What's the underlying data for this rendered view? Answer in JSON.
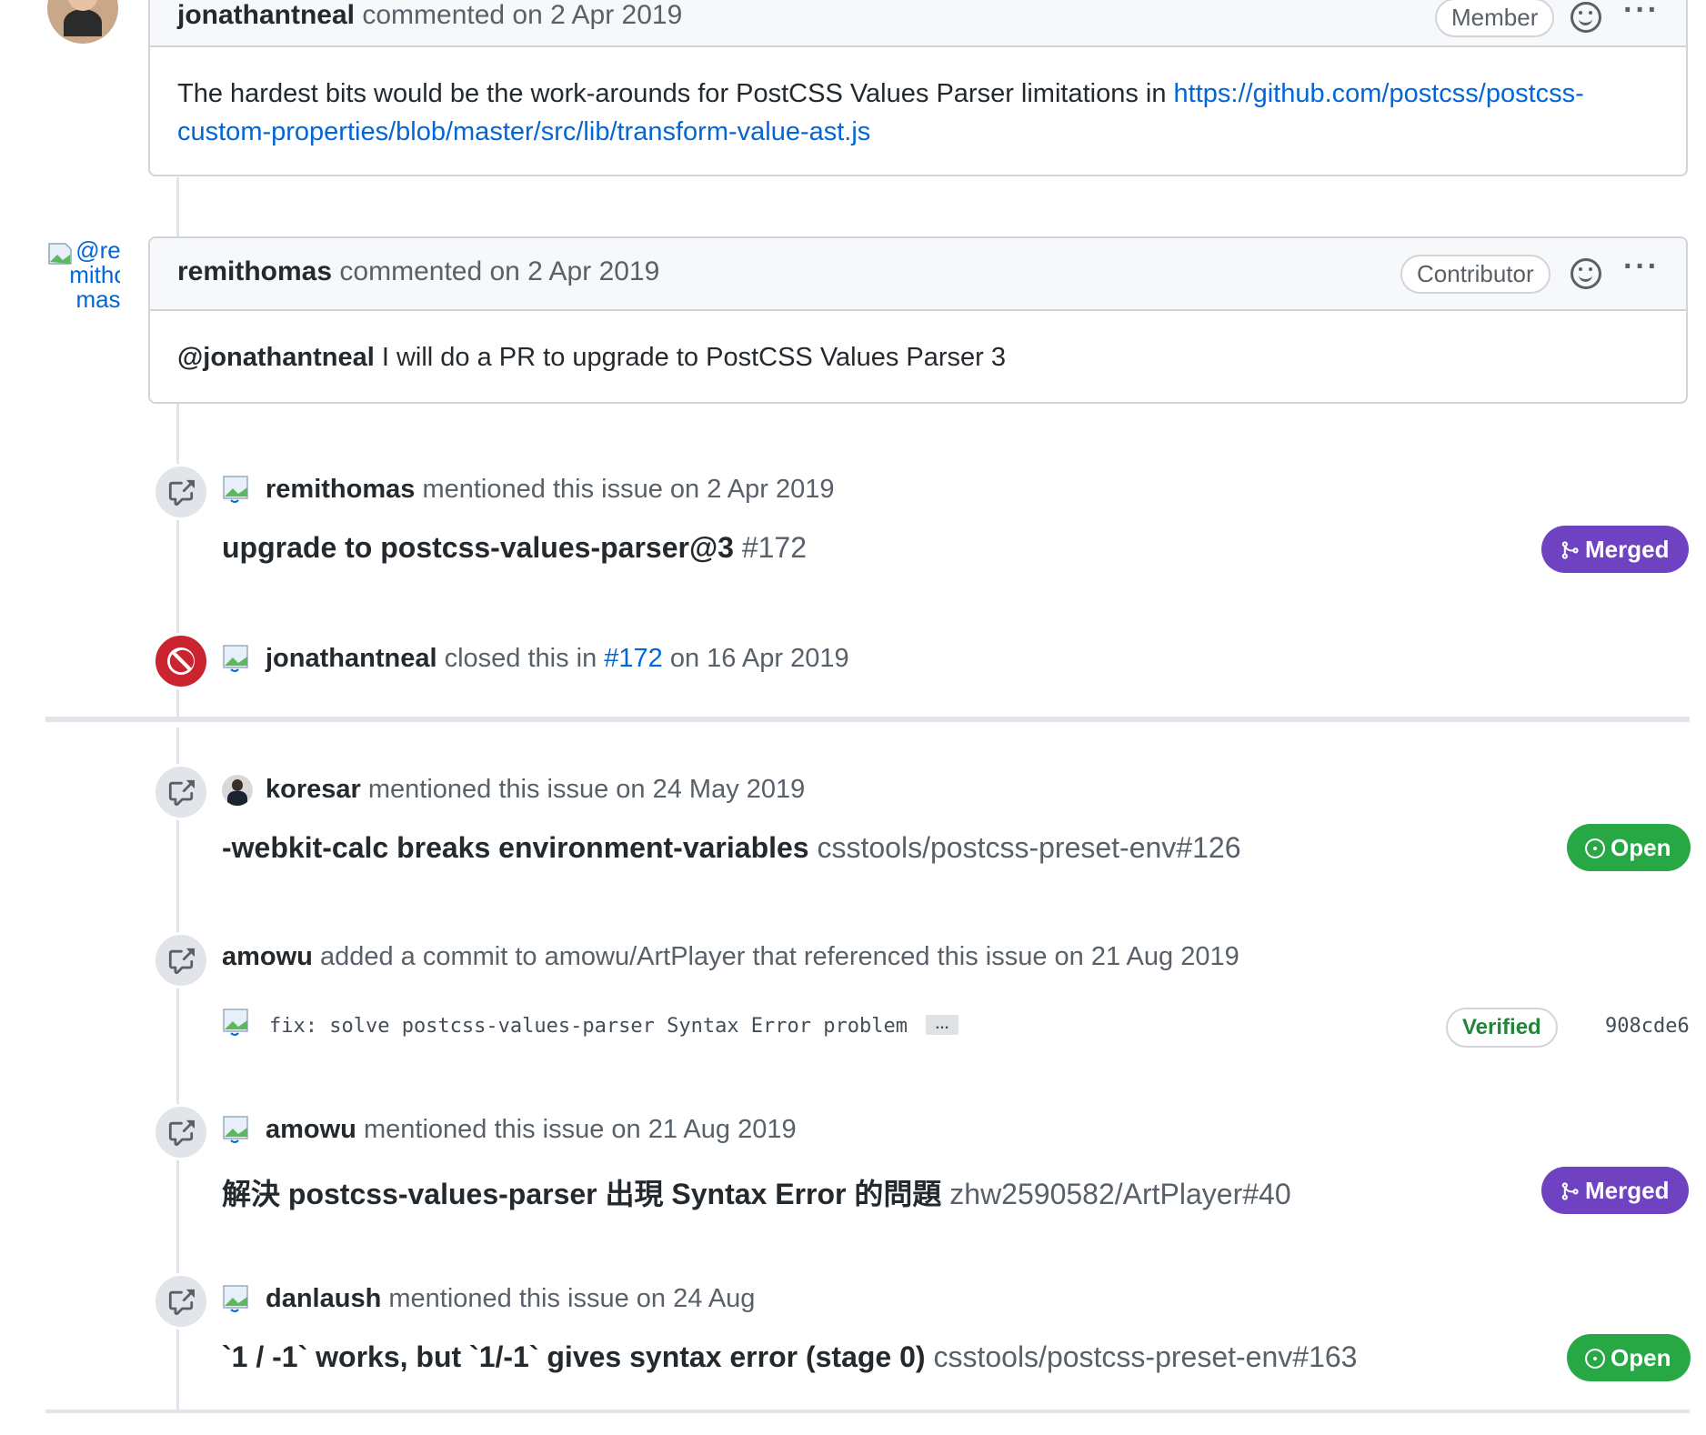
{
  "comments": [
    {
      "author": "jonathantneal",
      "action": "commented on 2 Apr 2019",
      "role": "Member",
      "body_prefix": "The hardest bits would be the work-arounds for PostCSS Values Parser limitations in ",
      "body_link": "https://github.com/postcss/postcss-custom-properties/blob/master/src/lib/transform-value-ast.js",
      "body_link_line1": "https://github.com/postcss/postcss-",
      "body_link_line2": "custom-properties/blob/master/src/lib/transform-value-ast.js"
    },
    {
      "author": "remithomas",
      "avatar_alt": "@remithomas",
      "action": "commented on 2 Apr 2019",
      "role": "Contributor",
      "body_mention": "@jonathantneal",
      "body_text": " I will do a PR to upgrade to PostCSS Values Parser 3"
    }
  ],
  "events": [
    {
      "actor": "remithomas",
      "text": "mentioned this issue on 2 Apr 2019",
      "title": "upgrade to postcss-values-parser@3",
      "ref": "#172",
      "state": "Merged"
    },
    {
      "actor": "jonathantneal",
      "text_before": "closed this in ",
      "link": "#172",
      "text_after": " on 16 Apr 2019"
    },
    {
      "actor": "koresar",
      "text": "mentioned this issue on 24 May 2019",
      "title": "-webkit-calc breaks environment-variables",
      "ref": "csstools/postcss-preset-env#126",
      "state": "Open"
    },
    {
      "actor": "amowu",
      "text": "added a commit to amowu/ArtPlayer that referenced this issue on 21 Aug 2019",
      "commit_message": "fix: solve postcss-values-parser Syntax Error problem",
      "commit_more": "…",
      "verified": "Verified",
      "sha": "908cde6"
    },
    {
      "actor": "amowu",
      "text": "mentioned this issue on 21 Aug 2019",
      "title": "解決 postcss-values-parser 出現 Syntax Error 的問題",
      "ref": "zhw2590582/ArtPlayer#40",
      "state": "Merged"
    },
    {
      "actor": "danlaush",
      "text": "mentioned this issue on 24 Aug",
      "title": "`1 / -1` works, but `1/-1` gives syntax error (stage 0)",
      "ref": "csstools/postcss-preset-env#163",
      "state": "Open"
    }
  ],
  "colors": {
    "merged": "#6f42c1",
    "open": "#28a745",
    "closed": "#cb2431",
    "link": "#0366d6"
  },
  "icons": {
    "reference": "cross-reference-icon",
    "closed": "circle-slash-icon",
    "merged": "git-merge-icon",
    "open": "issue-opened-icon",
    "reaction": "smiley-icon",
    "menu": "kebab-horizontal-icon"
  }
}
